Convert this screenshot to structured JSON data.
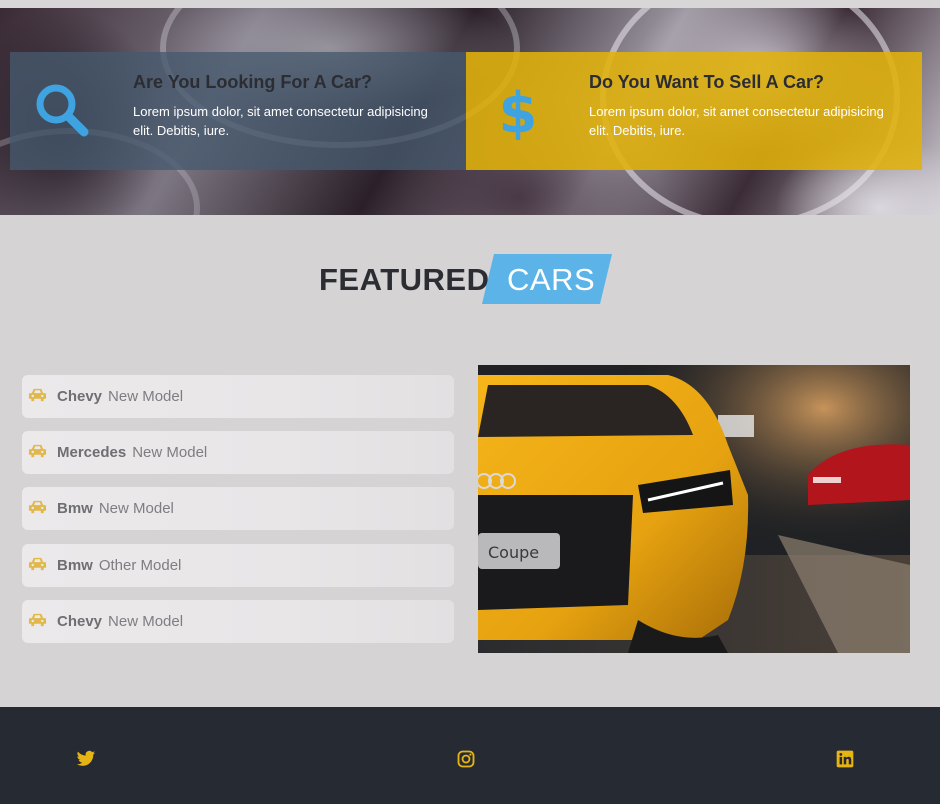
{
  "promos": [
    {
      "title": "Are You Looking For A Car?",
      "text": "Lorem ipsum dolor, sit amet consectetur adipisicing elit. Debitis, iure.",
      "icon": "search-icon"
    },
    {
      "title": "Do You Want To Sell A Car?",
      "text": "Lorem ipsum dolor, sit amet consectetur adipisicing elit. Debitis, iure.",
      "icon": "dollar-icon"
    }
  ],
  "featured": {
    "word1": "FEATURED",
    "word2": "CARS"
  },
  "models": [
    {
      "make": "Chevy",
      "model": "New Model"
    },
    {
      "make": "Mercedes",
      "model": "New Model"
    },
    {
      "make": "Bmw",
      "model": "New Model"
    },
    {
      "make": "Bmw",
      "model": "Other Model"
    },
    {
      "make": "Chevy",
      "model": "New Model"
    }
  ],
  "car_plate": "Coupe",
  "social": [
    "twitter-icon",
    "instagram-icon",
    "linkedin-icon"
  ],
  "colors": {
    "accent_blue": "#5bb3e8",
    "accent_yellow": "#e1b20a",
    "dark": "#262a32",
    "icon_blue": "#3ea3e0"
  }
}
